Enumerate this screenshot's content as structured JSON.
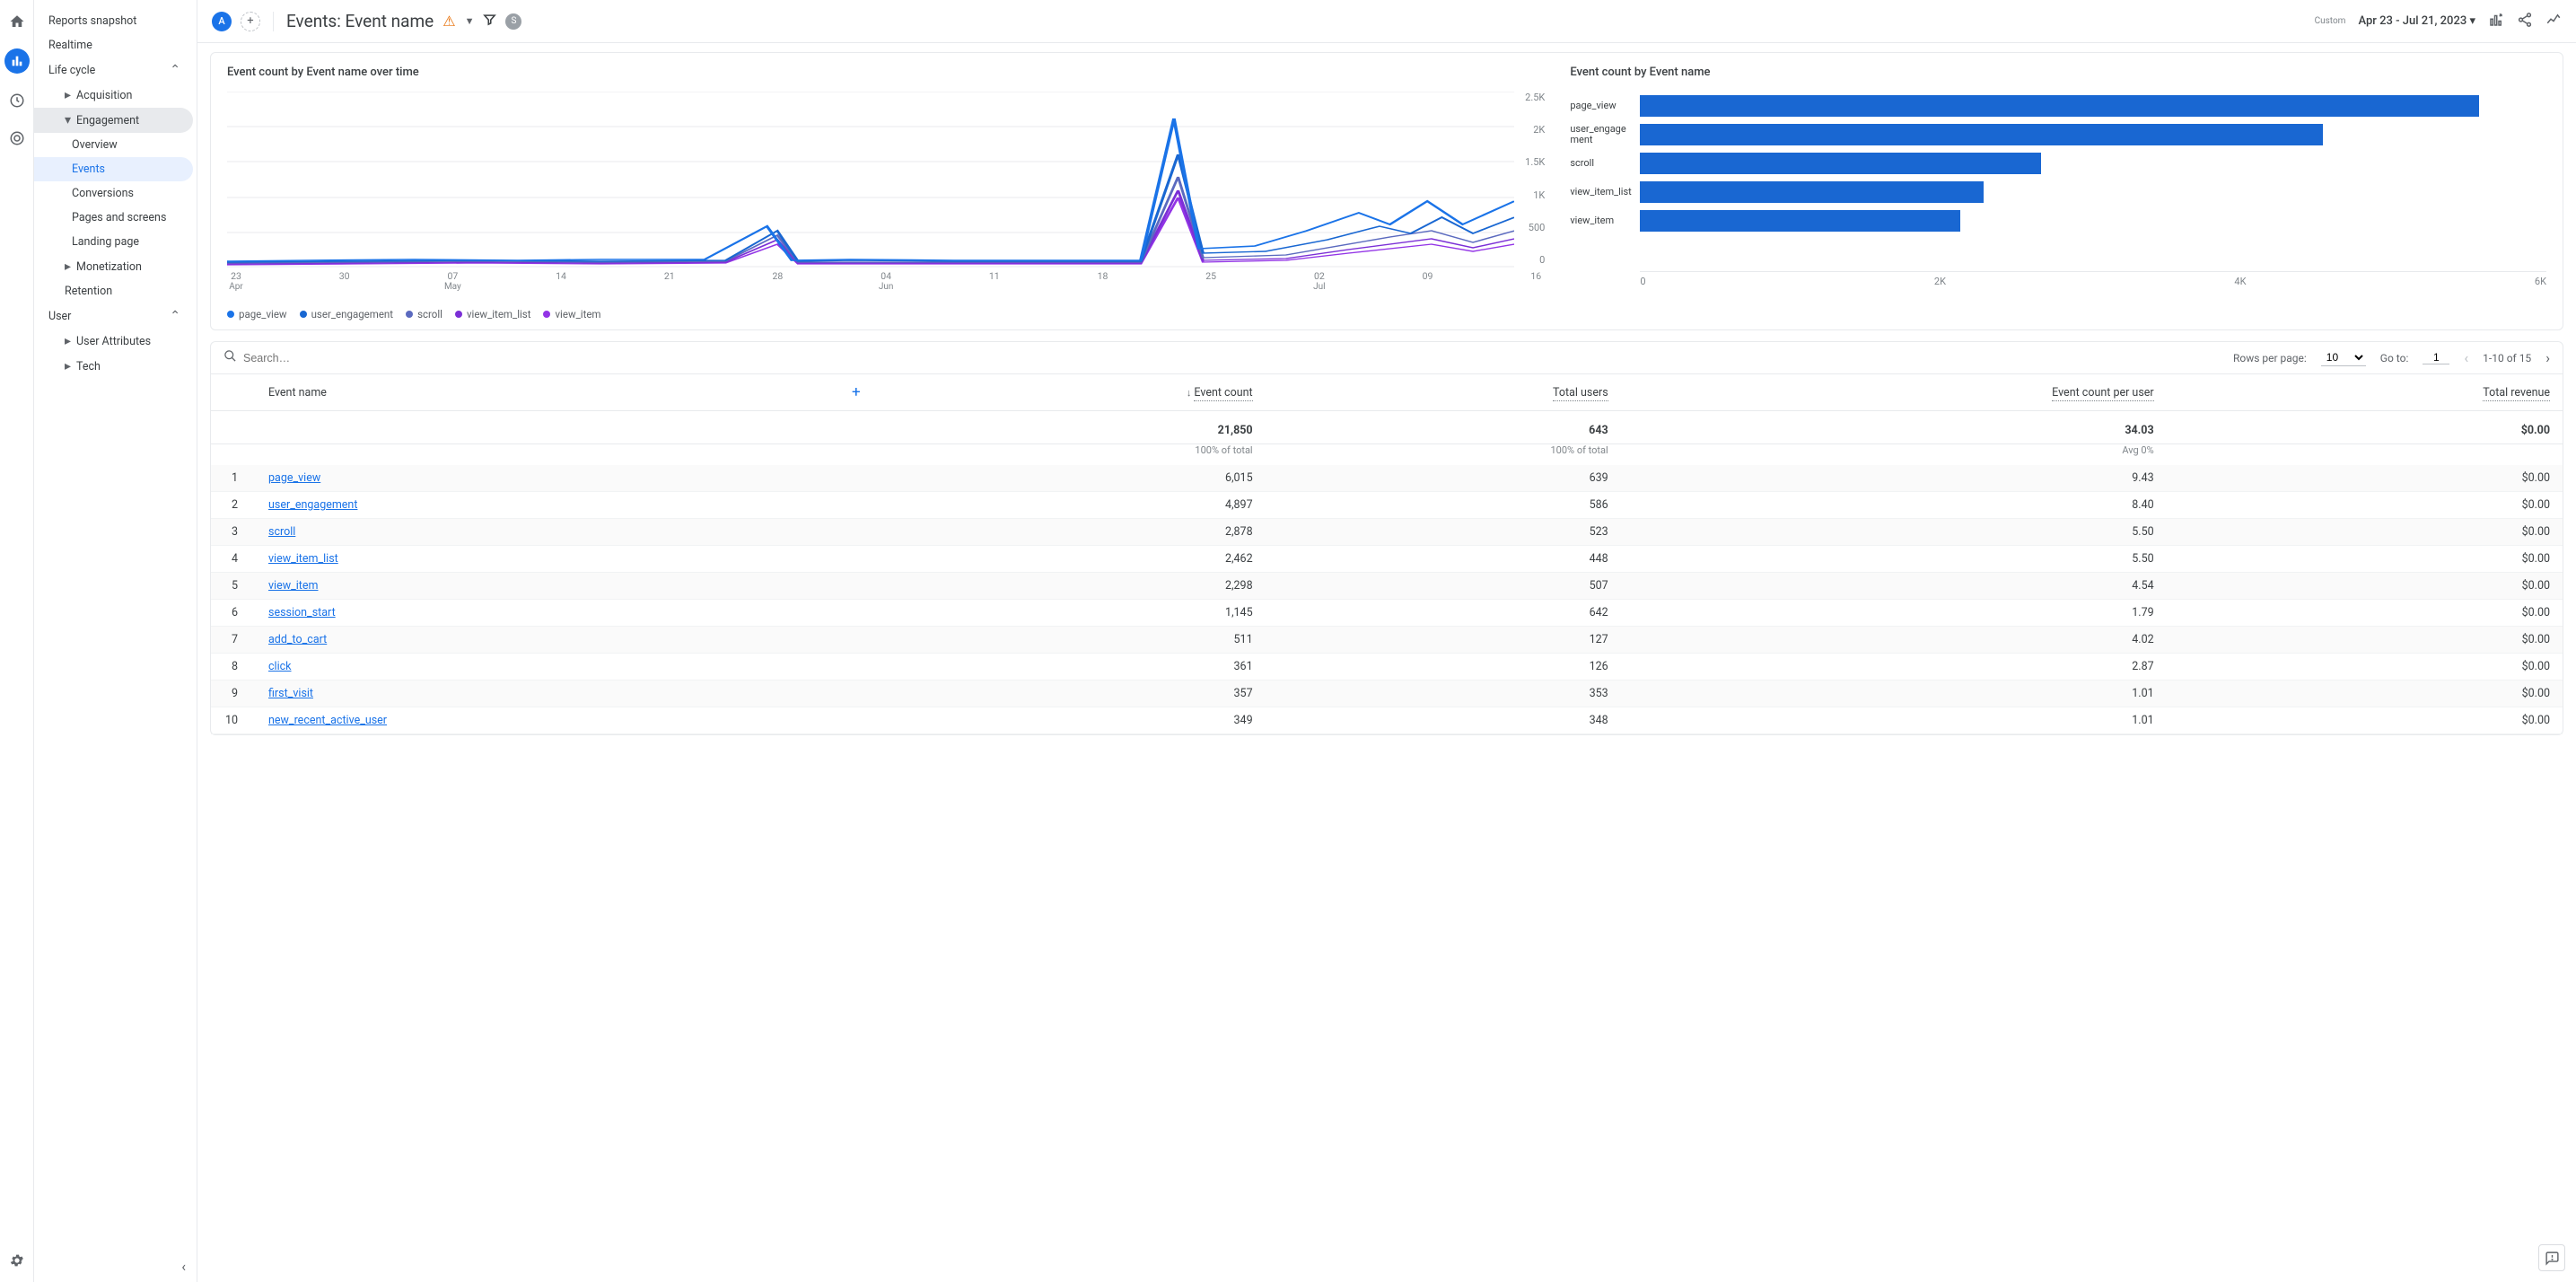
{
  "rail": {
    "icons": [
      "home",
      "reports",
      "explore",
      "advertising",
      "gear"
    ]
  },
  "sidebar": {
    "items": [
      {
        "label": "Reports snapshot",
        "type": "item"
      },
      {
        "label": "Realtime",
        "type": "item"
      },
      {
        "label": "Life cycle",
        "type": "section",
        "expanded": true
      },
      {
        "label": "Acquisition",
        "type": "sub",
        "caret": true
      },
      {
        "label": "Engagement",
        "type": "sub",
        "caret": true,
        "active_parent": true
      },
      {
        "label": "Overview",
        "type": "subsub"
      },
      {
        "label": "Events",
        "type": "subsub",
        "active": true
      },
      {
        "label": "Conversions",
        "type": "subsub"
      },
      {
        "label": "Pages and screens",
        "type": "subsub"
      },
      {
        "label": "Landing page",
        "type": "subsub"
      },
      {
        "label": "Monetization",
        "type": "sub",
        "caret": true
      },
      {
        "label": "Retention",
        "type": "sub"
      },
      {
        "label": "User",
        "type": "section",
        "expanded": true
      },
      {
        "label": "User Attributes",
        "type": "sub",
        "caret": true
      },
      {
        "label": "Tech",
        "type": "sub",
        "caret": true
      }
    ]
  },
  "header": {
    "chip_a": "A",
    "title": "Events: Event name",
    "chip_s": "S",
    "custom_label": "Custom",
    "date_range": "Apr 23 - Jul 21, 2023"
  },
  "charts": {
    "line_title": "Event count by Event name over time",
    "bar_title": "Event count by Event name",
    "y_ticks": [
      "2.5K",
      "2K",
      "1.5K",
      "1K",
      "500",
      "0"
    ],
    "x_ticks": [
      "23",
      "30",
      "07",
      "14",
      "21",
      "28",
      "04",
      "11",
      "18",
      "25",
      "02",
      "09",
      "16"
    ],
    "x_sub": {
      "0": "Apr",
      "2": "May",
      "6": "Jun",
      "10": "Jul"
    },
    "legend": [
      {
        "label": "page_view",
        "color": "#1a73e8"
      },
      {
        "label": "user_engagement",
        "color": "#1967d2"
      },
      {
        "label": "scroll",
        "color": "#5b6abf"
      },
      {
        "label": "view_item_list",
        "color": "#7b2fd6"
      },
      {
        "label": "view_item",
        "color": "#9334e6"
      }
    ],
    "bar_x_ticks": [
      "0",
      "2K",
      "4K",
      "6K"
    ]
  },
  "chart_data": {
    "type": "bar",
    "title": "Event count by Event name",
    "xlabel": "",
    "ylabel": "",
    "xlim": [
      0,
      6500
    ],
    "categories": [
      "page_view",
      "user_engagement",
      "scroll",
      "view_item_list",
      "view_item"
    ],
    "values": [
      6015,
      4897,
      2878,
      2462,
      2298
    ]
  },
  "line_chart_data": {
    "type": "line",
    "title": "Event count by Event name over time",
    "x_range": [
      "Apr 23 2023",
      "Jul 21 2023"
    ],
    "ylim": [
      0,
      2500
    ],
    "series": [
      {
        "name": "page_view",
        "color": "#1a73e8"
      },
      {
        "name": "user_engagement",
        "color": "#1967d2"
      },
      {
        "name": "scroll",
        "color": "#5b6abf"
      },
      {
        "name": "view_item_list",
        "color": "#7b2fd6"
      },
      {
        "name": "view_item",
        "color": "#9334e6"
      }
    ],
    "note": "Low baseline (~20-60) with small spike ~Jun 1 (~300) and large spike ~Jun 27 (page_view peaks ~2100, others ~1500-1000), moderate activity in July."
  },
  "table": {
    "search_placeholder": "Search…",
    "rows_per_page_label": "Rows per page:",
    "rows_per_page_value": "10",
    "goto_label": "Go to:",
    "goto_value": "1",
    "range_label": "1-10 of 15",
    "columns": [
      "Event name",
      "Event count",
      "Total users",
      "Event count per user",
      "Total revenue"
    ],
    "totals": {
      "event_count": "21,850",
      "total_users": "643",
      "per_user": "34.03",
      "revenue": "$0.00"
    },
    "totals_sub": {
      "event_count": "100% of total",
      "total_users": "100% of total",
      "per_user": "Avg 0%",
      "revenue": ""
    },
    "rows": [
      {
        "idx": "1",
        "name": "page_view",
        "event_count": "6,015",
        "total_users": "639",
        "per_user": "9.43",
        "revenue": "$0.00"
      },
      {
        "idx": "2",
        "name": "user_engagement",
        "event_count": "4,897",
        "total_users": "586",
        "per_user": "8.40",
        "revenue": "$0.00"
      },
      {
        "idx": "3",
        "name": "scroll",
        "event_count": "2,878",
        "total_users": "523",
        "per_user": "5.50",
        "revenue": "$0.00"
      },
      {
        "idx": "4",
        "name": "view_item_list",
        "event_count": "2,462",
        "total_users": "448",
        "per_user": "5.50",
        "revenue": "$0.00"
      },
      {
        "idx": "5",
        "name": "view_item",
        "event_count": "2,298",
        "total_users": "507",
        "per_user": "4.54",
        "revenue": "$0.00"
      },
      {
        "idx": "6",
        "name": "session_start",
        "event_count": "1,145",
        "total_users": "642",
        "per_user": "1.79",
        "revenue": "$0.00"
      },
      {
        "idx": "7",
        "name": "add_to_cart",
        "event_count": "511",
        "total_users": "127",
        "per_user": "4.02",
        "revenue": "$0.00"
      },
      {
        "idx": "8",
        "name": "click",
        "event_count": "361",
        "total_users": "126",
        "per_user": "2.87",
        "revenue": "$0.00"
      },
      {
        "idx": "9",
        "name": "first_visit",
        "event_count": "357",
        "total_users": "353",
        "per_user": "1.01",
        "revenue": "$0.00"
      },
      {
        "idx": "10",
        "name": "new_recent_active_user",
        "event_count": "349",
        "total_users": "348",
        "per_user": "1.01",
        "revenue": "$0.00"
      }
    ]
  }
}
